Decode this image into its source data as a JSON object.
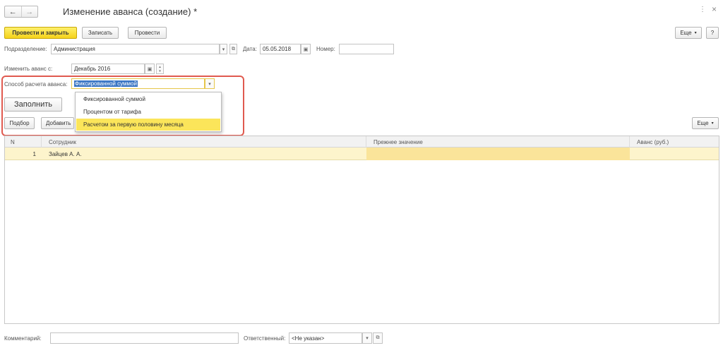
{
  "window": {
    "title": "Изменение аванса (создание) *",
    "back_icon": "←",
    "forward_icon": "→",
    "more_icon": "⋮",
    "close_icon": "×"
  },
  "toolbar": {
    "post_and_close": "Провести и закрыть",
    "save": "Записать",
    "post": "Провести",
    "more": "Еще",
    "help": "?"
  },
  "form": {
    "department_label": "Подразделение:",
    "department_value": "Администрация",
    "date_label": "Дата:",
    "date_value": "05.05.2018",
    "number_label": "Номер:",
    "number_value": "",
    "change_from_label": "Изменить аванс с:",
    "change_from_value": "Декабрь 2016",
    "method_label": "Способ расчета аванса:",
    "method_value": "Фиксированной суммой"
  },
  "dropdown": {
    "options": [
      "Фиксированной суммой",
      "Процентом от тарифа",
      "Расчетом за первую половину месяца"
    ],
    "highlighted_index": 2
  },
  "actions": {
    "fill": "Заполнить",
    "select": "Подбор",
    "add": "Добавить",
    "more": "Еще"
  },
  "table": {
    "columns": [
      "N",
      "Сотрудник",
      "Прежнее значение",
      "Аванс (руб.)"
    ],
    "rows": [
      {
        "n": "1",
        "employee": "Зайцев А. А.",
        "previous": "",
        "advance": ""
      }
    ]
  },
  "footer": {
    "comment_label": "Комментарий:",
    "comment_value": "",
    "responsible_label": "Ответственный:",
    "responsible_value": "<Не указан>"
  },
  "colors": {
    "accent_yellow": "#f5d21a",
    "highlight_frame": "#e05a4f",
    "row_selected": "#fdf4cc"
  }
}
